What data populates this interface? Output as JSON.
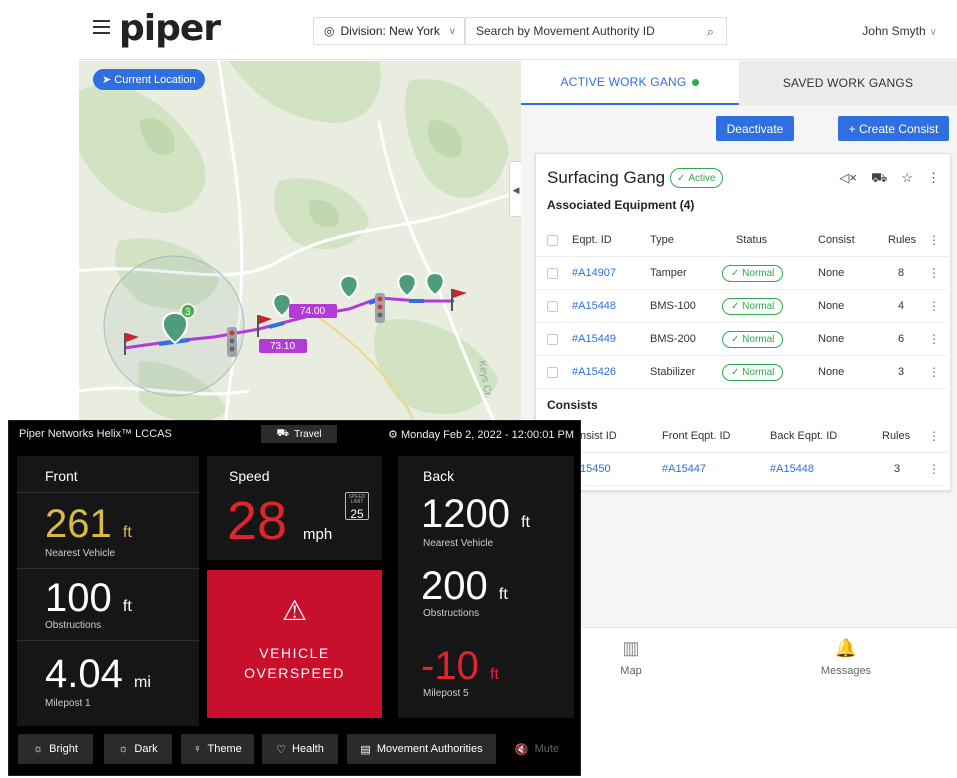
{
  "app": {
    "logo": "piper",
    "division_label": "Division: New York",
    "search_placeholder": "Search by Movement Authority ID",
    "user_name": "John Smyth"
  },
  "map": {
    "current_location": "Current Location",
    "cluster_count": "3",
    "milepost_tags": [
      "74.00",
      "73.10"
    ],
    "label_road": "Keys Cr"
  },
  "panel": {
    "tabs": [
      "ACTIVE WORK GANG",
      "SAVED WORK GANGS"
    ],
    "deactivate_label": "Deactivate",
    "create_consist_label": "+ Create Consist",
    "gang": {
      "name": "Surfacing Gang",
      "status": "Active",
      "equipment_heading": "Associated Equipment (4)",
      "equipment_columns": [
        "Eqpt. ID",
        "Type",
        "Status",
        "Consist",
        "Rules"
      ],
      "equipment_rows": [
        {
          "id": "#A14907",
          "type": "Tamper",
          "status": "Normal",
          "consist": "None",
          "rules": "8"
        },
        {
          "id": "#A15448",
          "type": "BMS-100",
          "status": "Normal",
          "consist": "None",
          "rules": "4"
        },
        {
          "id": "#A15449",
          "type": "BMS-200",
          "status": "Normal",
          "consist": "None",
          "rules": "6"
        },
        {
          "id": "#A15426",
          "type": "Stabilizer",
          "status": "Normal",
          "consist": "None",
          "rules": "3"
        }
      ],
      "consists_heading": "Consists",
      "consist_columns": [
        "Consist ID",
        "Front Eqpt. ID",
        "Back Eqpt. ID",
        "Rules"
      ],
      "consist_rows": [
        {
          "id": "#C15450",
          "front": "#A15447",
          "back": "#A15448",
          "rules": "3"
        }
      ]
    },
    "nav": [
      "Map",
      "Messages"
    ]
  },
  "helix": {
    "title": "Piper Networks Helix™ LCCAS",
    "mode": "Travel",
    "datetime": "Monday Feb 2, 2022 - 12:00:01 PM",
    "front": {
      "label": "Front",
      "nearest_value": "261",
      "nearest_unit": "ft",
      "nearest_label": "Nearest Vehicle",
      "obstruction_value": "100",
      "obstruction_unit": "ft",
      "obstruction_label": "Obstructions",
      "milepost_value": "4.04",
      "milepost_unit": "mi",
      "milepost_label": "Milepost 1"
    },
    "speed": {
      "label": "Speed",
      "value": "28",
      "unit": "mph",
      "sign_top": "SPEED LIMIT",
      "sign_value": "25"
    },
    "alert": {
      "line1": "VEHICLE",
      "line2": "OVERSPEED"
    },
    "back": {
      "label": "Back",
      "nearest_value": "1200",
      "nearest_unit": "ft",
      "nearest_label": "Nearest Vehicle",
      "obstruction_value": "200",
      "obstruction_unit": "ft",
      "obstruction_label": "Obstructions",
      "milepost_value": "-10",
      "milepost_unit": "ft",
      "milepost_label": "Milepost 5"
    },
    "buttons": [
      "Bright",
      "Dark",
      "Theme",
      "Health",
      "Movement Authorities",
      "Mute"
    ]
  },
  "colors": {
    "accent_blue": "#2f6fe0",
    "status_green": "#2fa84f",
    "alert_red": "#c8102e",
    "speed_red": "#e0242e",
    "front_yellow": "#d9b94a",
    "route_magenta": "#b43ad8"
  }
}
